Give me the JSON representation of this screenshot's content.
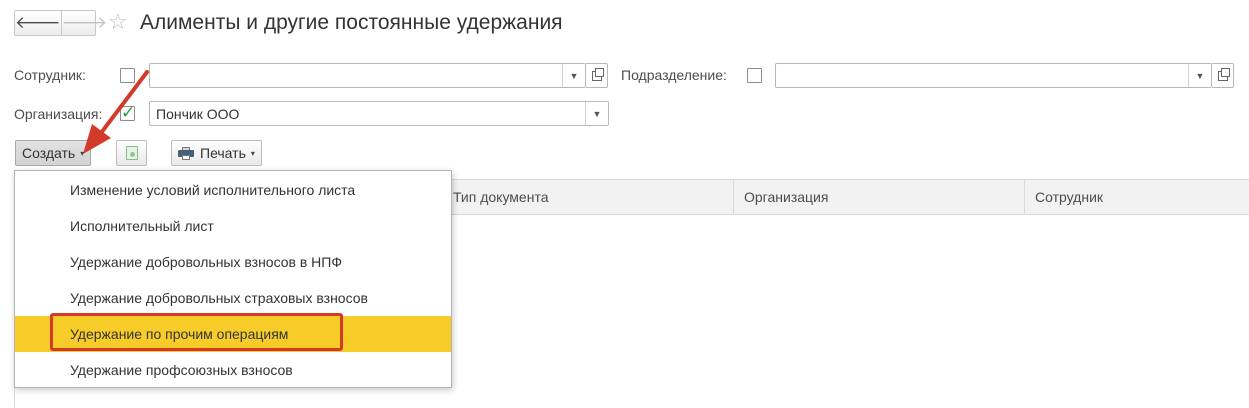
{
  "nav": {
    "back_icon": "arrow-left",
    "forward_icon": "arrow-right",
    "back_glyph": "🡐",
    "forward_glyph": "🡒"
  },
  "header": {
    "favorite_glyph": "☆",
    "title": "Алименты и другие постоянные удержания"
  },
  "filters": {
    "employee_label": "Сотрудник:",
    "employee_checked": false,
    "employee_value": "",
    "department_label": "Подразделение:",
    "department_checked": false,
    "department_value": "",
    "organization_label": "Организация:",
    "organization_checked": true,
    "organization_value": "Пончик ООО",
    "check_glyph": "✓",
    "dropdown_glyph": "▼"
  },
  "toolbar": {
    "create_label": "Создать",
    "print_label": "Печать",
    "caret_glyph": "▾"
  },
  "table": {
    "columns": [
      "Тип документа",
      "Организация",
      "Сотрудник"
    ]
  },
  "create_menu": {
    "items": [
      "Изменение условий исполнительного листа",
      "Исполнительный лист",
      "Удержание добровольных взносов в НПФ",
      "Удержание добровольных страховых взносов",
      "Удержание по прочим операциям",
      "Удержание профсоюзных взносов"
    ],
    "selected_index": 4
  },
  "colors": {
    "selected": "#f8cc28",
    "annotation": "#d23a2a",
    "check": "#2e9a3a"
  }
}
